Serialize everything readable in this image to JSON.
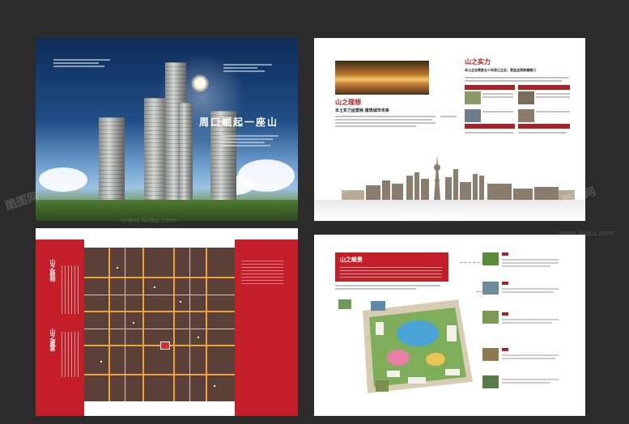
{
  "cover": {
    "title": "周口崛起一座山"
  },
  "strength_page": {
    "left_title": "山之理想",
    "left_subtitle": "本土实力运营商  建筑城市未来",
    "right_title": "山之实力",
    "right_subtitle": "本土企业铁肤五十年浙江企业，黄金品质筑福周口"
  },
  "map_page": {
    "left_label_1": "山之脉相",
    "left_label_2": "山之盛宴"
  },
  "landscape_page": {
    "title": "山之峻景"
  },
  "watermark": {
    "brand": "酷图网",
    "url": "www.ikutu.com"
  },
  "colors": {
    "accent_red": "#c41f28",
    "background": "#2b2b2b"
  }
}
